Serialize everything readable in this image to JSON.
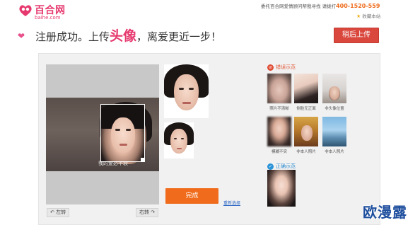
{
  "header": {
    "logo_brand": "百合网",
    "logo_domain": "baihe.com",
    "info_text": "委托百合网爱情顾问帮我寻找 请拨打",
    "hotline": "400-1520-559",
    "favorite_label": "收藏本站"
  },
  "title": {
    "prefix": "注册成功。上传",
    "highlight": "头像",
    "suffix": "，离爱更近一步！",
    "later_button": "稍后上传"
  },
  "editor": {
    "photo_caption": "我的爱必不衰",
    "rotate_left": "左转",
    "rotate_right": "右转",
    "done_button": "完成",
    "reselect_link": "重新选择"
  },
  "examples": {
    "wrong_heading": "错误示范",
    "right_heading": "正确示范",
    "wrong_captions": [
      "照片不清晰",
      "侧脸无正面",
      "非头像位置",
      "模糊不实",
      "非本人照片",
      "非本人照片"
    ]
  },
  "watermark": "欧漫露",
  "colors": {
    "brand_pink": "#e6396f",
    "later_button": "#d9473d",
    "done_button": "#f06c1c",
    "hotline": "#ee6b1b",
    "wrong_icon": "#e04b33",
    "right_icon": "#2b93d8"
  },
  "icons": [
    "heart-logo-icon",
    "star-icon",
    "pink-heart-icon",
    "rotate-left-icon",
    "rotate-right-icon",
    "wrong-icon",
    "right-icon"
  ]
}
